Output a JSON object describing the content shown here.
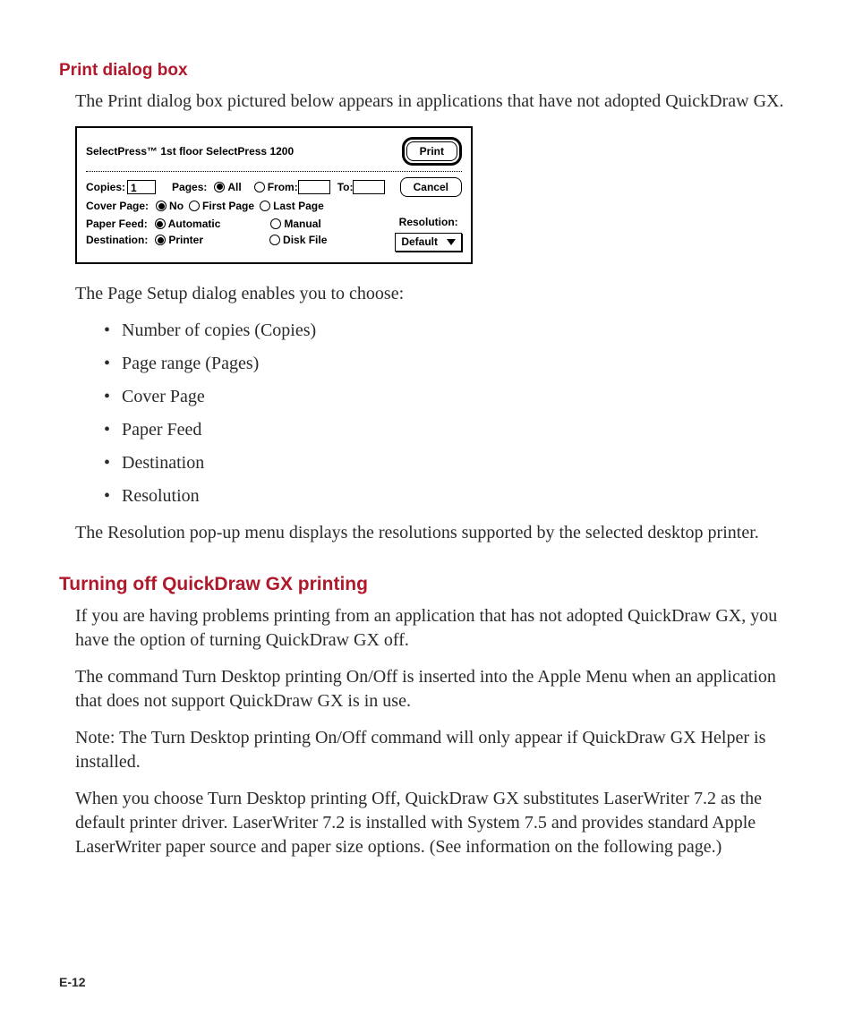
{
  "headings": {
    "print_dialog": "Print dialog box",
    "turning_off": "Turning off QuickDraw GX printing"
  },
  "paragraphs": {
    "intro": "The Print dialog box pictured below appears in applications that have not adopted QuickDraw GX.",
    "enables": "The Page Setup dialog enables you to choose:",
    "resolution": "The Resolution pop-up menu displays the resolutions supported by the selected desktop printer.",
    "t1": "If you are having problems printing from an application that has not adopted QuickDraw GX, you have the option of turning QuickDraw GX off.",
    "t2": "The command Turn Desktop printing On/Off is inserted into the Apple Menu when an application that does not support QuickDraw GX is in use.",
    "t3": "Note: The Turn Desktop printing On/Off command will only appear if QuickDraw GX Helper is installed.",
    "t4": "When you choose Turn Desktop printing Off, QuickDraw GX substitutes LaserWriter 7.2 as the default printer driver. LaserWriter 7.2 is installed with System 7.5 and provides standard Apple LaserWriter paper source and paper size options. (See information on the following page.)"
  },
  "bullets": [
    "Number of copies (Copies)",
    "Page range (Pages)",
    "Cover Page",
    "Paper Feed",
    "Destination",
    "Resolution"
  ],
  "dialog": {
    "title": "SelectPress™ 1st floor SelectPress 1200",
    "buttons": {
      "print": "Print",
      "cancel": "Cancel"
    },
    "copies": {
      "label": "Copies:",
      "value": "1"
    },
    "pages": {
      "label": "Pages:",
      "all": "All",
      "from": "From:",
      "to": "To:"
    },
    "cover": {
      "label": "Cover Page:",
      "no": "No",
      "first": "First Page",
      "last": "Last Page"
    },
    "feed": {
      "label": "Paper Feed:",
      "auto": "Automatic",
      "manual": "Manual"
    },
    "dest": {
      "label": "Destination:",
      "printer": "Printer",
      "disk": "Disk File"
    },
    "resolution": {
      "label": "Resolution:",
      "value": "Default"
    }
  },
  "page_number": "E-12"
}
